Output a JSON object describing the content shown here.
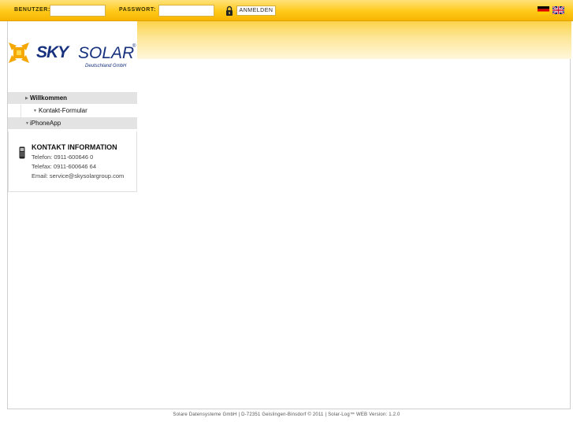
{
  "login": {
    "user_label": "BENUTZER:",
    "user_value": "",
    "password_label": "PASSWORT:",
    "password_value": "",
    "submit_label": "ANMELDEN"
  },
  "languages": [
    "de",
    "en"
  ],
  "logo": {
    "sky": "SKY",
    "solar": "SOLAR",
    "reg": "®",
    "subtitle": "Deutschland GmbH"
  },
  "nav": {
    "items": [
      {
        "label": "Willkommen"
      },
      {
        "label": "Kontakt-Formular"
      },
      {
        "label": "iPhoneApp"
      }
    ]
  },
  "contact": {
    "title": "KONTAKT INFORMATION",
    "phone": "Telefon: 0911-600646 0",
    "fax": "Telefax: 0911-600646 64",
    "email": "Email: service@skysolargroup.com"
  },
  "footer": {
    "text": "Solare Datensysteme GmbH    | D-72351 Geislingen-Binsdorf © 2011 | Solar-Log™ WEB Version: 1.2.0"
  },
  "colors": {
    "bar_yellow": "#ffc91a",
    "brand_blue": "#17317e",
    "logo_orange": "#f5a800"
  }
}
